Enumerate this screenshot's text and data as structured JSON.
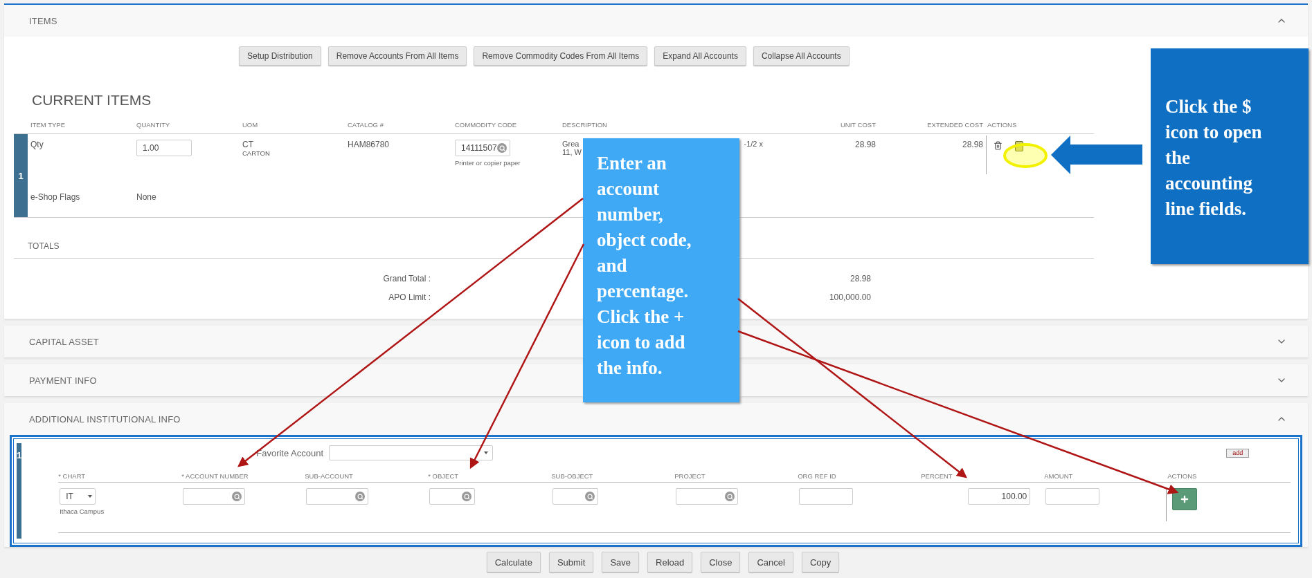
{
  "items_panel": {
    "title": "ITEMS",
    "expanded": true,
    "toolbar": [
      "Setup Distribution",
      "Remove Accounts From All Items",
      "Remove Commodity Codes From All Items",
      "Expand All Accounts",
      "Collapse All Accounts"
    ],
    "heading": "CURRENT ITEMS",
    "columns": [
      "ITEM TYPE",
      "QUANTITY",
      "UOM",
      "CATALOG #",
      "COMMODITY CODE",
      "DESCRIPTION",
      "UNIT COST",
      "EXTENDED COST",
      "ACTIONS"
    ],
    "rows": [
      {
        "number": "1",
        "item_type": "Qty",
        "quantity": "1.00",
        "uom": "CT",
        "uom_name": "CARTON",
        "catalog": "HAM86780",
        "commodity_code": "14111507",
        "commodity_name": "Printer or copier paper",
        "description_lines": [
          "Grea",
          "11, W"
        ],
        "description_tail": "-1/2 x",
        "unit_cost": "28.98",
        "extended_cost": "28.98",
        "flags_label": "e-Shop Flags",
        "flags_value": "None"
      }
    ],
    "totals": {
      "title": "TOTALS",
      "lines": [
        {
          "label": "Grand Total :",
          "value": "28.98"
        },
        {
          "label": "APO Limit :",
          "value": "100,000.00"
        }
      ]
    }
  },
  "sections": [
    {
      "title": "CAPITAL ASSET",
      "expanded": false
    },
    {
      "title": "PAYMENT INFO",
      "expanded": false
    },
    {
      "title": "ADDITIONAL INSTITUTIONAL INFO",
      "expanded": true
    }
  ],
  "accounting": {
    "number": "1",
    "favorite_label": "Favorite Account",
    "add_label": "add",
    "columns": [
      "* CHART",
      "* ACCOUNT NUMBER",
      "SUB-ACCOUNT",
      "* OBJECT",
      "SUB-OBJECT",
      "PROJECT",
      "ORG REF ID",
      "PERCENT",
      "AMOUNT",
      "ACTIONS"
    ],
    "cells": [
      {
        "kind": "select",
        "value": "IT",
        "note": "Ithaca Campus"
      },
      {
        "kind": "lookup"
      },
      {
        "kind": "lookup"
      },
      {
        "kind": "lookup"
      },
      {
        "kind": "lookup"
      },
      {
        "kind": "lookup"
      },
      {
        "kind": "input"
      },
      {
        "kind": "input",
        "value": "100.00"
      },
      {
        "kind": "input"
      },
      {
        "kind": "add"
      }
    ]
  },
  "buttons": [
    "Calculate",
    "Submit",
    "Save",
    "Reload",
    "Close",
    "Cancel",
    "Copy"
  ],
  "callouts": [
    {
      "text": "Enter an account number, object code, and percentage. Click the + icon to add the info.",
      "color": "#3fa9f5"
    },
    {
      "text": "Click the $ icon to open the accounting line fields.",
      "color": "#0f6fc2"
    }
  ]
}
